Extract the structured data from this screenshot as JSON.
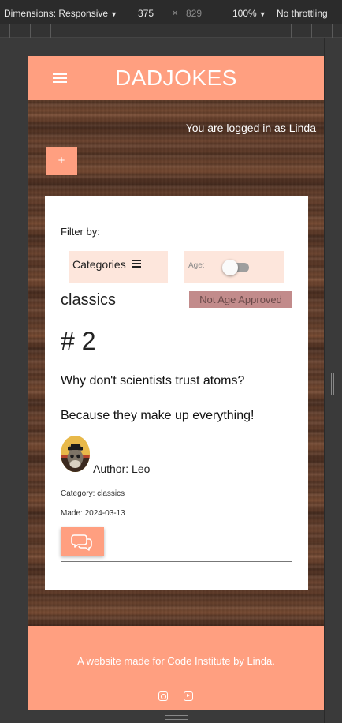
{
  "devtools": {
    "dimensions_label": "Dimensions: Responsive",
    "width": "375",
    "times": "×",
    "height": "829",
    "zoom": "100%",
    "throttling": "No throttling"
  },
  "site": {
    "brand": "DADJOKES",
    "logged_in_text": "You are logged in as Linda",
    "add_label": "+"
  },
  "filter": {
    "label": "Filter by:",
    "categories_label": "Categories",
    "age_label": "Age:",
    "age_toggle_on": false
  },
  "joke": {
    "category_heading": "classics",
    "badge": "Not Age Approved",
    "number": "# 2",
    "question": "Why don't scientists trust atoms?",
    "answer": "Because they make up everything!",
    "author": "Author: Leo",
    "category_meta": "Category: classics",
    "made_meta": "Made: 2024-03-13"
  },
  "footer": {
    "text": "A website made for Code Institute by Linda.",
    "icons": [
      "instagram-icon",
      "youtube-icon"
    ]
  },
  "colors": {
    "accent": "#ff9f80",
    "filter_bg": "#fde6dc",
    "badge_bg": "#c28b8b"
  }
}
